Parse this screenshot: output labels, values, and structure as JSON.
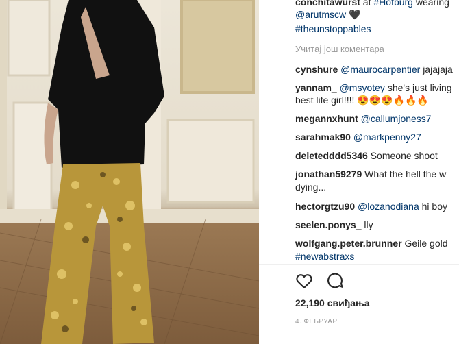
{
  "caption": {
    "username": "conchitawurst",
    "text1": "at",
    "hashtag1": "#Hofburg",
    "text2": "wearing",
    "mention": "@arutmscw",
    "heart": "🖤",
    "hashtag2": "#theunstoppables"
  },
  "load_more": "Учитај још коментара",
  "comments": [
    {
      "user": "cynshure",
      "mention": "@maurocarpentier",
      "text": "jajajaja"
    },
    {
      "user": "yannam_",
      "mention": "@msyotey",
      "text": "she's just living",
      "text2": "best life girl!!!! 😍😍😍🔥🔥🔥"
    },
    {
      "user": "megannxhunt",
      "mention": "@callumjoness7",
      "text": ""
    },
    {
      "user": "sarahmak90",
      "mention": "@markpenny27",
      "text": ""
    },
    {
      "user": "deletedddd5346",
      "mention": "",
      "text": "Someone shoot"
    },
    {
      "user": "jonathan59279",
      "mention": "",
      "text": "What the hell the w",
      "text2": "dying..."
    },
    {
      "user": "hectorgtzu90",
      "mention": "@lozanodiana",
      "text": "hi boy"
    },
    {
      "user": "seelen.ponys_",
      "mention": "",
      "text": "lly"
    },
    {
      "user": "wolfgang.peter.brunner",
      "mention": "",
      "text": "Geile gold",
      "tag": "#newabstraxs"
    }
  ],
  "actions": {
    "like_icon": "heart-outline-icon",
    "comment_icon": "speech-bubble-icon"
  },
  "likes": "22,190 свиђања",
  "date": "4. ФЕБРУАР",
  "colors": {
    "link": "#003569",
    "text": "#262626",
    "muted": "#999999"
  }
}
